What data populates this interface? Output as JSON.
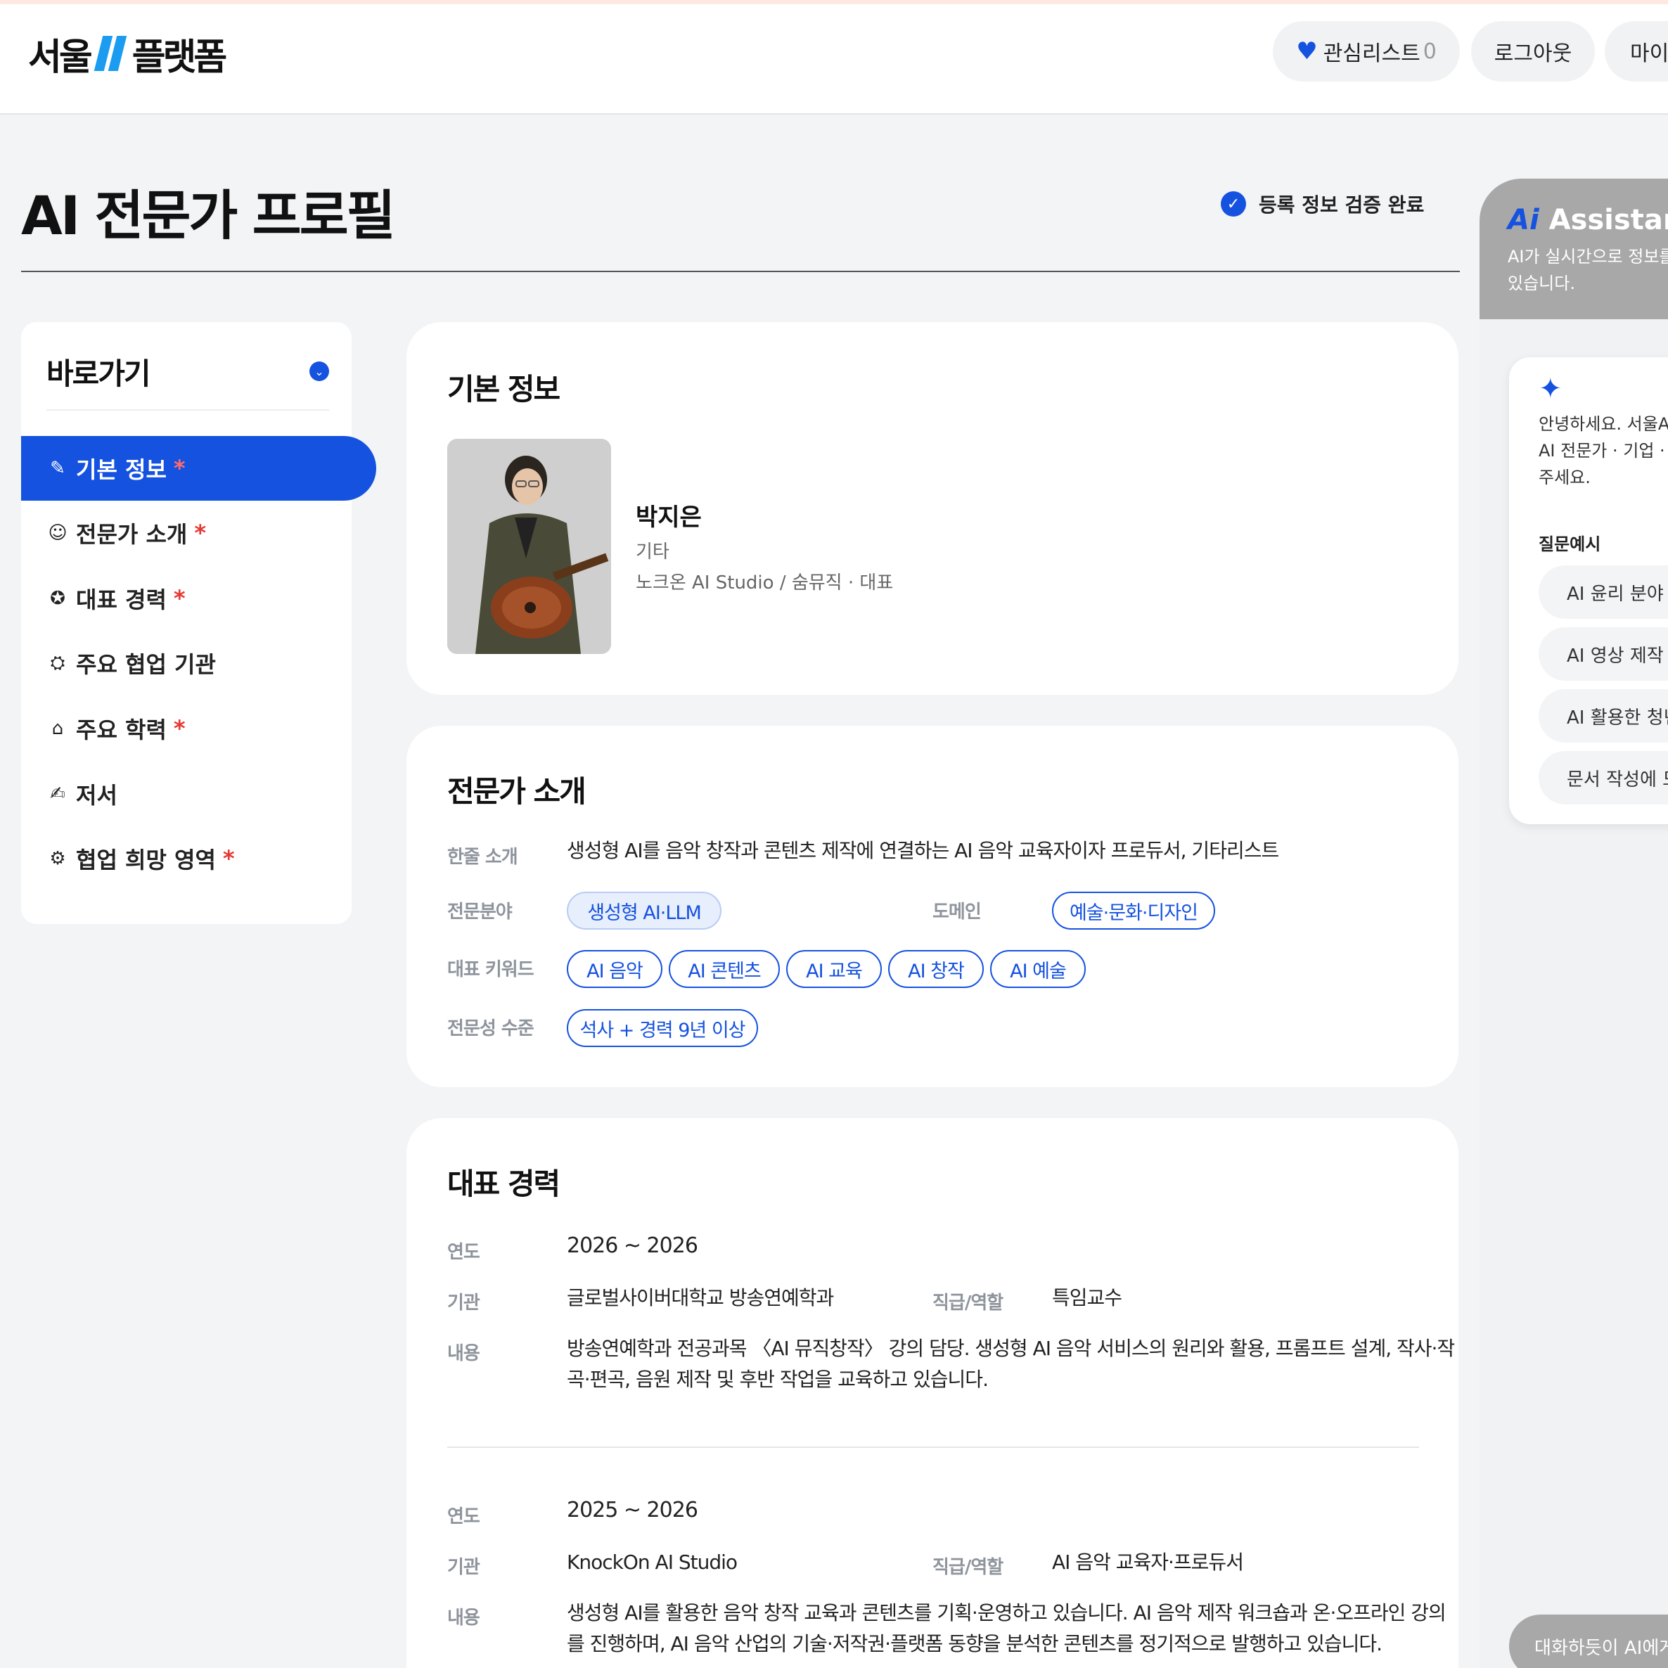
{
  "header": {
    "logo_left": "서울",
    "logo_right": "플랫폼",
    "watchlist_label": "관심리스트",
    "watchlist_count": "0",
    "logout_label": "로그아웃",
    "mypage_label": "마이"
  },
  "page": {
    "title": "AI 전문가 프로필",
    "verified_label": "등록 정보 검증 완료"
  },
  "shortcut": {
    "title": "바로가기",
    "items": [
      {
        "label": "기본 정보",
        "required": "*",
        "icon": "pencil-icon"
      },
      {
        "label": "전문가 소개",
        "required": "*",
        "icon": "user-circle-icon"
      },
      {
        "label": "대표 경력",
        "required": "*",
        "icon": "award-icon"
      },
      {
        "label": "주요 협업 기관",
        "required": "",
        "icon": "handshake-icon"
      },
      {
        "label": "주요 학력",
        "required": "*",
        "icon": "graduation-cap-icon"
      },
      {
        "label": "저서",
        "required": "",
        "icon": "signature-icon"
      },
      {
        "label": "협업 희망 영역",
        "required": "*",
        "icon": "settings-plus-icon"
      }
    ]
  },
  "basic": {
    "title": "기본 정보",
    "name": "박지은",
    "category": "기타",
    "affiliation": "노크온 AI Studio / 숨뮤직 · 대표"
  },
  "intro": {
    "title": "전문가 소개",
    "one_line_label": "한줄 소개",
    "one_line": "생성형 AI를 음악 창작과 콘텐츠 제작에 연결하는 AI 음악 교육자이자 프로듀서, 기타리스트",
    "field_label": "전문분야",
    "field_value": "생성형 AI·LLM",
    "domain_label": "도메인",
    "domain_value": "예술·문화·디자인",
    "keywords_label": "대표 키워드",
    "keywords": [
      "AI 음악",
      "AI 콘텐츠",
      "AI 교육",
      "AI 창작",
      "AI 예술"
    ],
    "level_label": "전문성 수준",
    "level_value": "석사 + 경력 9년 이상"
  },
  "career": {
    "title": "대표 경력",
    "year_label": "연도",
    "org_label": "기관",
    "role_label": "직급/역할",
    "content_label": "내용",
    "entries": [
      {
        "year": "2026 ~ 2026",
        "org": "글로벌사이버대학교 방송연예학과",
        "role": "특임교수",
        "content_line1": "방송연예학과 전공과목 〈AI 뮤직창작〉 강의 담당. 생성형 AI 음악 서비스의 원리와 활용, 프롬프트 설계, 작사·작",
        "content_line2": "곡·편곡, 음원 제작 및 후반 작업을 교육하고 있습니다."
      },
      {
        "year": "2025 ~ 2026",
        "org": "KnockOn AI Studio",
        "role": "AI 음악 교육자·프로듀서",
        "content_line1": "생성형 AI를 활용한 음악 창작 교육과 콘텐츠를 기획·운영하고 있습니다. AI 음악 제작 워크숍과 온·오프라인 강의",
        "content_line2": "를 진행하며, AI 음악 산업의 기술·저작권·플랫폼 동향을 분석한 콘텐츠를 정기적으로 발행하고 있습니다."
      }
    ]
  },
  "assistant": {
    "title_ai": "Ai",
    "title_rest": "Assistant",
    "desc_line1": "AI가 실시간으로 정보를",
    "desc_line2": "있습니다.",
    "greet_line1": "안녕하세요. 서울AI",
    "greet_line2": "AI 전문가 · 기업 · 정",
    "greet_line3": "주세요.",
    "question_label": "질문예시",
    "questions": [
      "AI 윤리 분야 전",
      "AI 영상 제작 솔",
      "AI 활용한 청년",
      "문서 작성에 도"
    ],
    "input_placeholder": "대화하듯이 AI에게"
  }
}
